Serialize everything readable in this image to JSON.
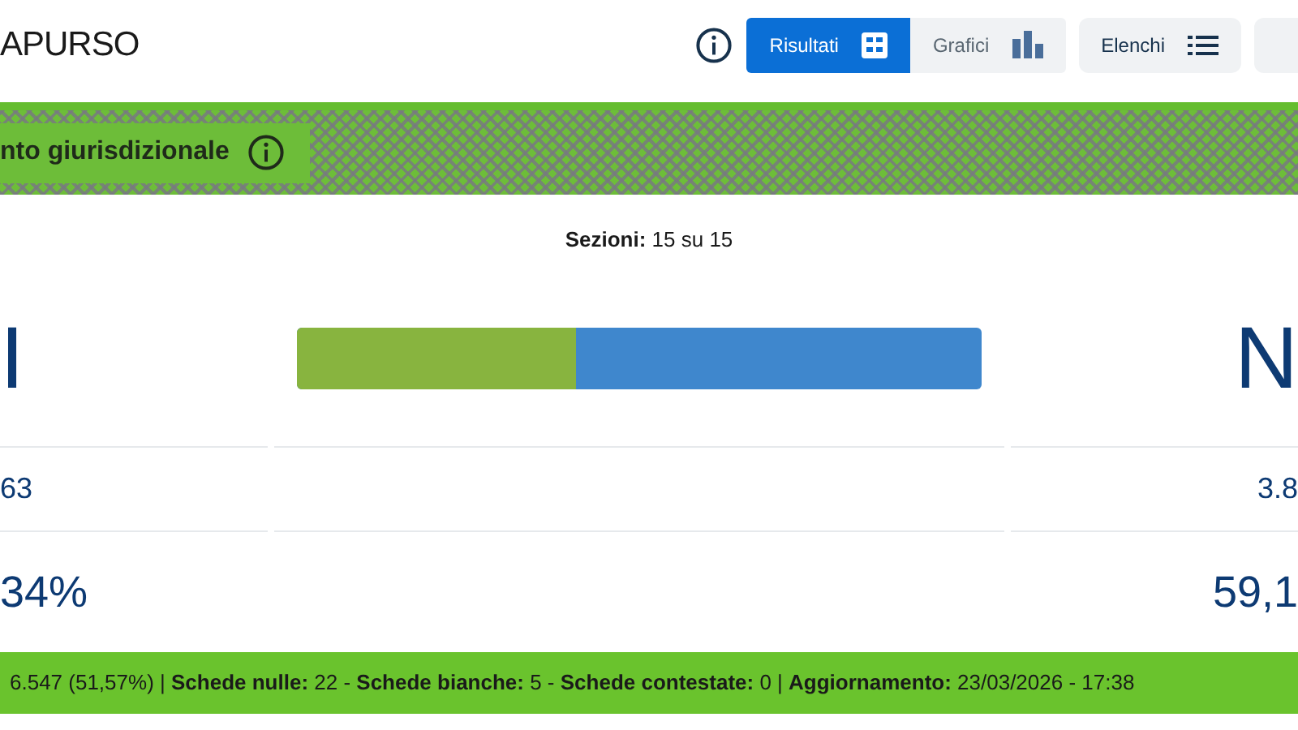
{
  "header": {
    "title": "APURSO",
    "tabs": [
      {
        "label": "Risultati",
        "kind": "grid",
        "selected": true
      },
      {
        "label": "Grafici",
        "kind": "bars",
        "selected": false
      }
    ],
    "list_button": {
      "label": "Elenchi"
    }
  },
  "banner": {
    "label": "nto giurisdizionale"
  },
  "sections": {
    "text": "**Sezioni:** 15 su 15"
  },
  "yes": {
    "label": "I",
    "votes": "63",
    "percent": "34%"
  },
  "no": {
    "label": "N",
    "votes": "3.8",
    "percent": "59,1"
  },
  "split": {
    "level": 0.407
  },
  "footer": {
    "text": "6.547 (51,57%) | **Schede nulle:** 22 - **Schede bianche:** 5 - **Schede contestate:** 0 | **Aggiornamento:** 23/03/2026 - 17:38"
  }
}
